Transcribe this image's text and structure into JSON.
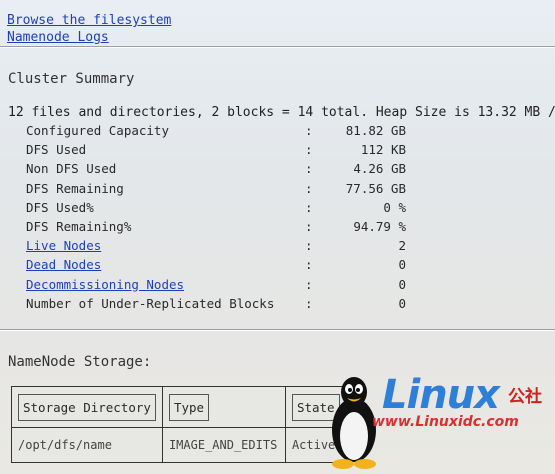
{
  "nav": {
    "browse_link": "Browse the filesystem",
    "logs_link": "Namenode Logs"
  },
  "cluster_summary": {
    "title": "Cluster Summary",
    "summary_line": "12 files and directories, 2 blocks = 14 total. Heap Size is 13.32 MB /",
    "stats": [
      {
        "label": "Configured Capacity",
        "colon": ":",
        "value": "81.82 GB",
        "link": false
      },
      {
        "label": "DFS Used",
        "colon": ":",
        "value": "112 KB",
        "link": false
      },
      {
        "label": "Non DFS Used",
        "colon": ":",
        "value": "4.26 GB",
        "link": false
      },
      {
        "label": "DFS Remaining",
        "colon": ":",
        "value": "77.56 GB",
        "link": false
      },
      {
        "label": "DFS Used%",
        "colon": ":",
        "value": "0 %",
        "link": false
      },
      {
        "label": "DFS Remaining%",
        "colon": ":",
        "value": "94.79 %",
        "link": false
      },
      {
        "label": "Live Nodes",
        "colon": ":",
        "value": "2",
        "link": true
      },
      {
        "label": "Dead Nodes",
        "colon": ":",
        "value": "0",
        "link": true
      },
      {
        "label": "Decommissioning Nodes",
        "colon": ":",
        "value": "0",
        "link": true
      },
      {
        "label": "Number of Under-Replicated Blocks",
        "colon": ":",
        "value": "0",
        "link": false
      }
    ]
  },
  "storage": {
    "title": "NameNode Storage:",
    "headers": [
      "Storage Directory",
      "Type",
      "State"
    ],
    "rows": [
      [
        "/opt/dfs/name",
        "IMAGE_AND_EDITS",
        "Active"
      ]
    ]
  },
  "watermark": {
    "brand": "Linux",
    "brand_cn": "公社",
    "url": "www.Linuxidc.com",
    "icon": "tux-penguin-icon",
    "colors": {
      "brand": "#2e7fd8",
      "cn": "#d02020",
      "url": "#d83030"
    }
  },
  "colors": {
    "link": "#1f3fb8",
    "text": "#2a2a2a"
  }
}
